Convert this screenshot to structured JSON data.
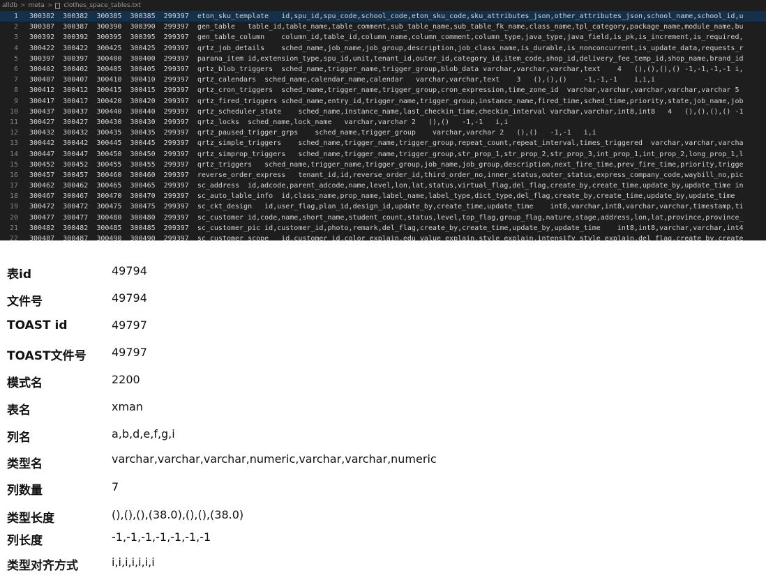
{
  "breadcrumb": [
    "alldb",
    "meta",
    "clothes_space_tables.txt"
  ],
  "editor_lines": [
    {
      "n": "1",
      "text": "300382  300382  300385  300385  299397  eton_sku_template   id,spu_id,spu_code,school_code,eton_sku_code,sku_attributes_json,other_attributes_json,school_name,school_id,u"
    },
    {
      "n": "2",
      "text": "300387  300387  300390  300390  299397  gen_table   table_id,table_name,table_comment,sub_table_name,sub_table_fk_name,class_name,tpl_category,package_name,module_name,bu"
    },
    {
      "n": "3",
      "text": "300392  300392  300395  300395  299397  gen_table_column    column_id,table_id,column_name,column_comment,column_type,java_type,java_field,is_pk,is_increment,is_required,"
    },
    {
      "n": "4",
      "text": "300422  300422  300425  300425  299397  qrtz_job_details    sched_name,job_name,job_group,description,job_class_name,is_durable,is_nonconcurrent,is_update_data,requests_r"
    },
    {
      "n": "5",
      "text": "300397  300397  300400  300400  299397  parana_item id,extension_type,spu_id,unit,tenant_id,outer_id,category_id,item_code,shop_id,delivery_fee_temp_id,shop_name,brand_id"
    },
    {
      "n": "6",
      "text": "300402  300402  300405  300405  299397  qrtz_blob_triggers  sched_name,trigger_name,trigger_group,blob_data varchar,varchar,varchar,text    4   (),(),(),() -1,-1,-1,-1 i,"
    },
    {
      "n": "7",
      "text": "300407  300407  300410  300410  299397  qrtz_calendars  sched_name,calendar_name,calendar   varchar,varchar,text    3   (),(),()    -1,-1,-1    i,i,i"
    },
    {
      "n": "8",
      "text": "300412  300412  300415  300415  299397  qrtz_cron_triggers  sched_name,trigger_name,trigger_group,cron_expression,time_zone_id  varchar,varchar,varchar,varchar,varchar 5"
    },
    {
      "n": "9",
      "text": "300417  300417  300420  300420  299397  qrtz_fired_triggers sched_name,entry_id,trigger_name,trigger_group,instance_name,fired_time,sched_time,priority,state,job_name,job"
    },
    {
      "n": "10",
      "text": "300437  300437  300440  300440  299397  qrtz_scheduler_state    sched_name,instance_name,last_checkin_time,checkin_interval varchar,varchar,int8,int8   4   (),(),(),() -1"
    },
    {
      "n": "11",
      "text": "300427  300427  300430  300430  299397  qrtz_locks  sched_name,lock_name   varchar,varchar 2   (),()   -1,-1   i,i"
    },
    {
      "n": "12",
      "text": "300432  300432  300435  300435  299397  qrtz_paused_trigger_grps    sched_name,trigger_group    varchar,varchar 2   (),()   -1,-1   i,i"
    },
    {
      "n": "13",
      "text": "300442  300442  300445  300445  299397  qrtz_simple_triggers    sched_name,trigger_name,trigger_group,repeat_count,repeat_interval,times_triggered  varchar,varchar,varcha"
    },
    {
      "n": "14",
      "text": "300447  300447  300450  300450  299397  qrtz_simprop_triggers   sched_name,trigger_name,trigger_group,str_prop_1,str_prop_2,str_prop_3,int_prop_1,int_prop_2,long_prop_1,l"
    },
    {
      "n": "15",
      "text": "300452  300452  300455  300455  299397  qrtz_triggers   sched_name,trigger_name,trigger_group,job_name,job_group,description,next_fire_time,prev_fire_time,priority,trigge"
    },
    {
      "n": "16",
      "text": "300457  300457  300460  300460  299397  reverse_order_express   tenant_id,id,reverse_order_id,third_order_no,inner_status,outer_status,express_company_code,waybill_no,pic"
    },
    {
      "n": "17",
      "text": "300462  300462  300465  300465  299397  sc_address  id,adcode,parent_adcode,name,level,lon,lat,status,virtual_flag,del_flag,create_by,create_time,update_by,update_time in"
    },
    {
      "n": "18",
      "text": "300467  300467  300470  300470  299397  sc_auto_lable_info  id,class_name,prop_name,label_name,label_type,dict_type,del_flag,create_by,create_time,update_by,update_time"
    },
    {
      "n": "19",
      "text": "300472  300472  300475  300475  299397  sc_ckt_design   id,user_flag,plan_id,design_id,update_by,create_time,update_time    int8,varchar,int8,varchar,varchar,timestamp,ti"
    },
    {
      "n": "20",
      "text": "300477  300477  300480  300480  299397  sc_customer id,code,name,short_name,student_count,status,level,top_flag,group_flag,nature,stage,address,lon,lat,province,province_"
    },
    {
      "n": "21",
      "text": "300482  300482  300485  300485  299397  sc_customer_pic id,customer_id,photo,remark,del_flag,create_by,create_time,update_by,update_time    int8,int8,varchar,varchar,int4"
    },
    {
      "n": "22",
      "text": "300487  300487  300490  300490  299397  sc_customer_scope   id,customer_id,color_explain,edu_value_explain,style_explain,intensify_style_explain,del_flag,create_by,create"
    }
  ],
  "details": [
    {
      "label": "表id",
      "value": "49794"
    },
    {
      "label": "文件号",
      "value": "49794"
    },
    {
      "label": "TOAST id",
      "value": "49797"
    },
    {
      "label": "TOAST文件号",
      "value": "49797"
    },
    {
      "label": "模式名",
      "value": "2200"
    },
    {
      "label": "表名",
      "value": "xman"
    },
    {
      "label": "列名",
      "value": "a,b,d,e,f,g,i"
    },
    {
      "label": "类型名",
      "value": "varchar,varchar,varchar,numeric,varchar,varchar,numeric"
    },
    {
      "label": "列数量",
      "value": "7"
    },
    {
      "label": "类型长度",
      "value": "(),(),(),(38.0),(),(),(38.0)"
    },
    {
      "label": "列长度",
      "value": "-1,-1,-1,-1,-1,-1,-1"
    },
    {
      "label": "类型对齐方式",
      "value": "i,i,i,i,i,i,i"
    }
  ]
}
